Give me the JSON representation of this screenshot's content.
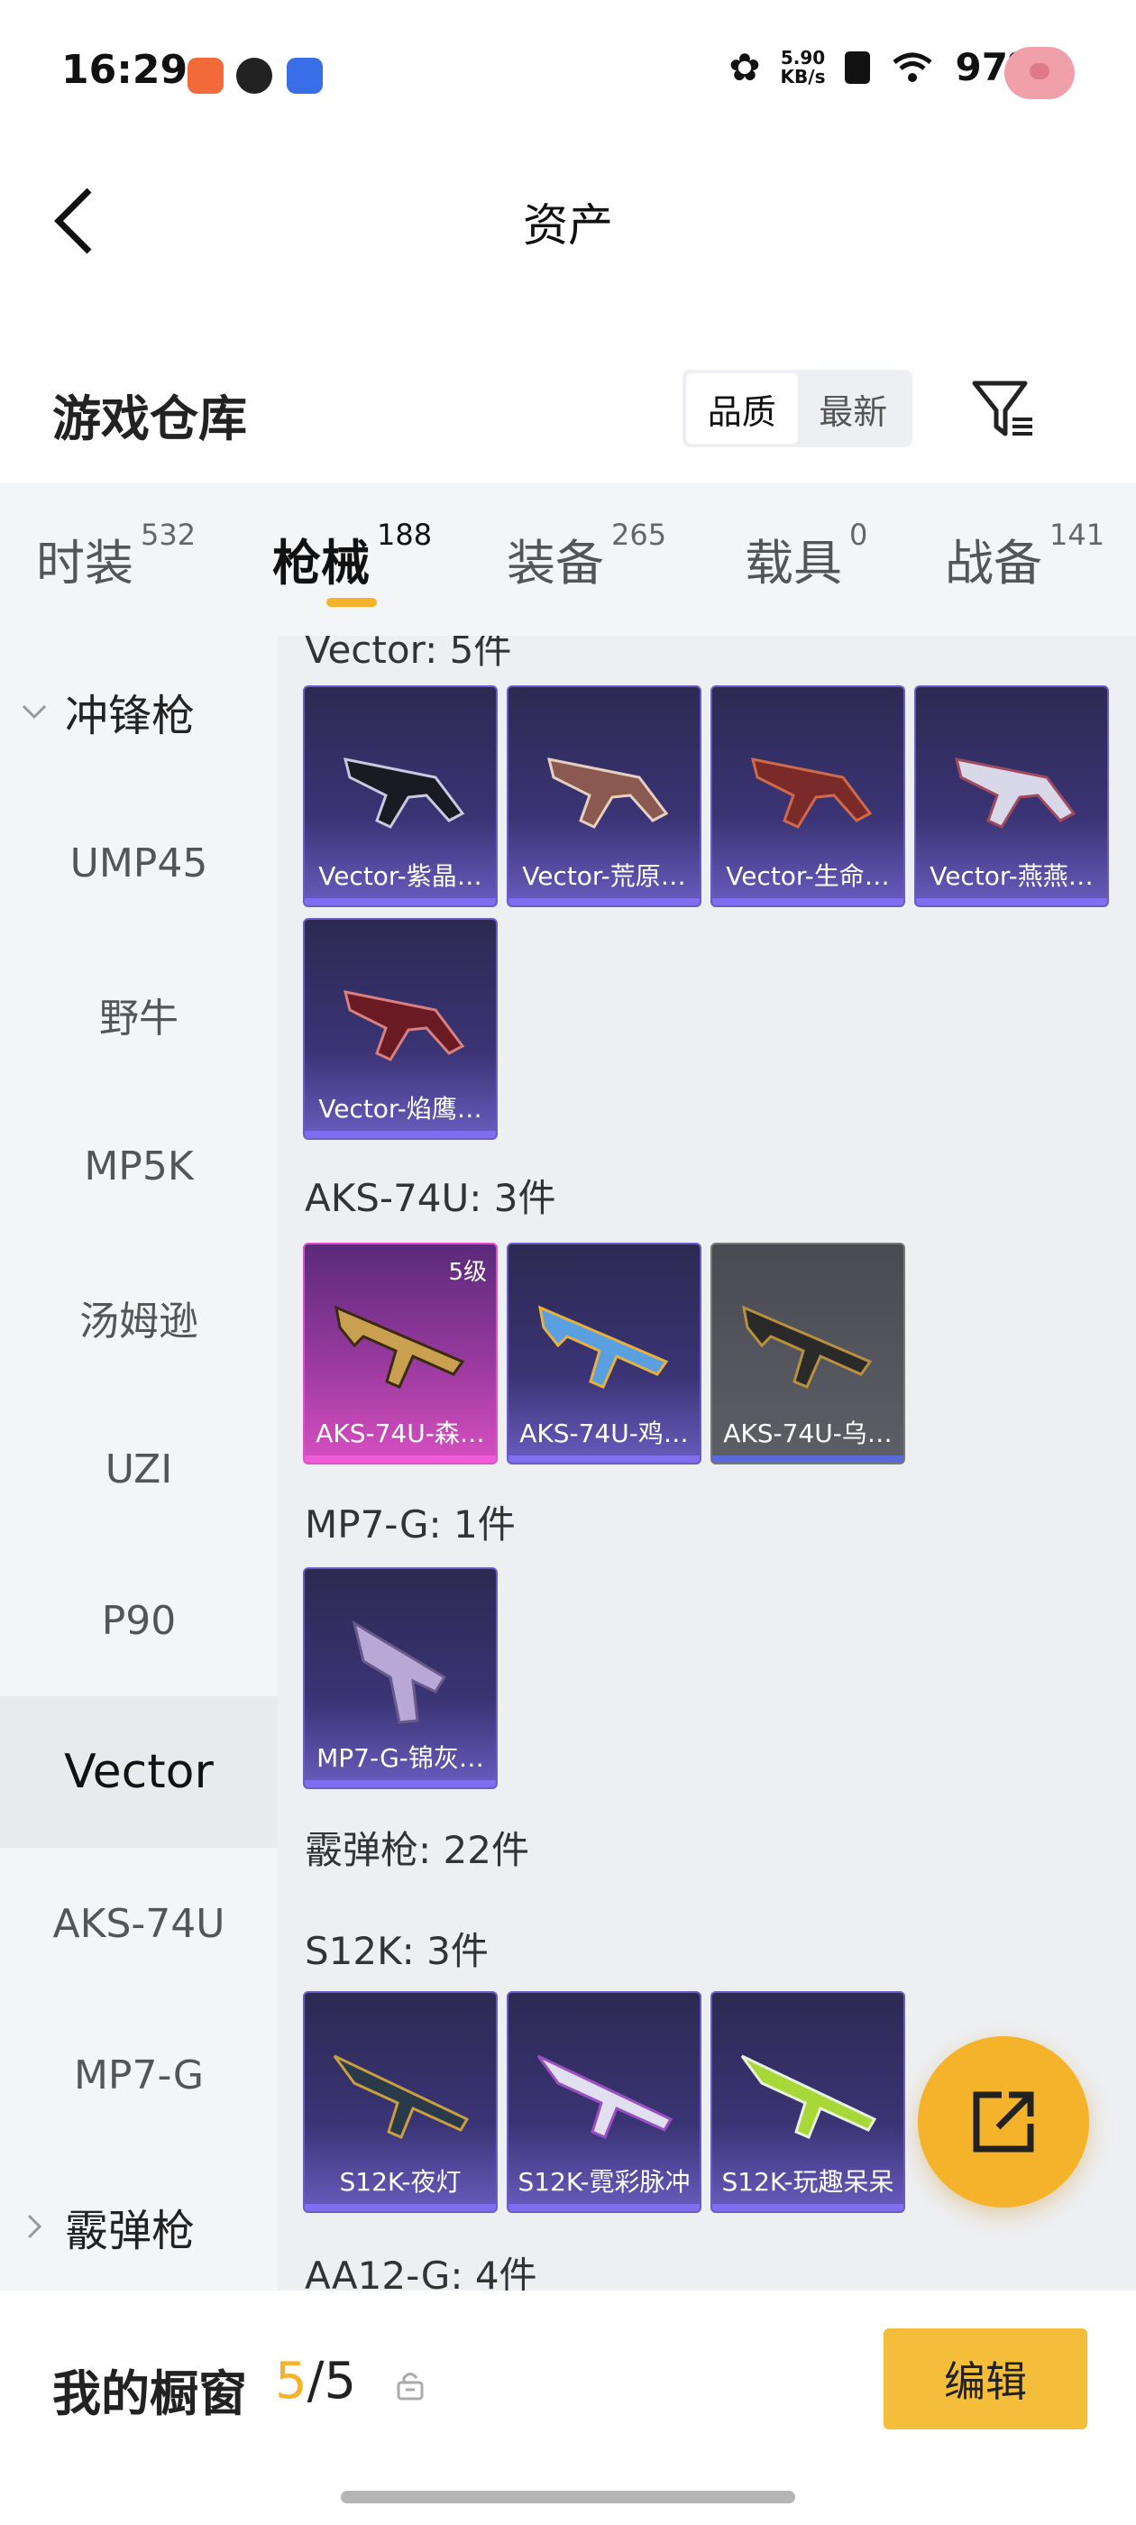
{
  "status_bar": {
    "time": "16:29",
    "net_speed_value": "5.90",
    "net_speed_unit": "KB/s",
    "battery": "97%"
  },
  "header": {
    "title": "资产"
  },
  "warehouse": {
    "title": "游戏仓库",
    "sort_options": [
      "品质",
      "最新"
    ],
    "active_sort": "品质"
  },
  "tabs": [
    {
      "label": "时装",
      "count": "532"
    },
    {
      "label": "枪械",
      "count": "188",
      "active": true
    },
    {
      "label": "装备",
      "count": "265"
    },
    {
      "label": "载具",
      "count": "0"
    },
    {
      "label": "战备",
      "count": "141"
    }
  ],
  "sidebar": {
    "group_smg": "冲锋枪",
    "items": [
      "UMP45",
      "野牛",
      "MP5K",
      "汤姆逊",
      "UZI",
      "P90",
      "Vector",
      "AKS-74U",
      "MP7-G"
    ],
    "active": "Vector",
    "group_shotgun": "霰弹枪"
  },
  "sections": {
    "vector": {
      "title": "Vector: 5件",
      "cards": [
        "Vector-紫晶…",
        "Vector-荒原…",
        "Vector-生命…",
        "Vector-燕燕…",
        "Vector-焰鹰…"
      ]
    },
    "aks": {
      "title": "AKS-74U: 3件",
      "cards": [
        "AKS-74U-森…",
        "AKS-74U-鸡…",
        "AKS-74U-乌…"
      ],
      "badge": "5级"
    },
    "mp7": {
      "title": "MP7-G: 1件",
      "cards": [
        "MP7-G-锦灰…"
      ]
    },
    "shotgun_total": "霰弹枪: 22件",
    "s12k": {
      "title": "S12K: 3件",
      "cards": [
        "S12K-夜灯",
        "S12K-霓彩脉冲",
        "S12K-玩趣呆呆"
      ]
    },
    "aa12": {
      "title": "AA12-G: 4件"
    }
  },
  "bottom": {
    "title": "我的橱窗",
    "count_current": "5",
    "count_total": "/5",
    "edit_label": "编辑"
  },
  "colors": {
    "accent": "#f4b32a",
    "card_purple": "#3a3475",
    "card_pink": "#d84fc0",
    "card_gray": "#5d5e66"
  }
}
